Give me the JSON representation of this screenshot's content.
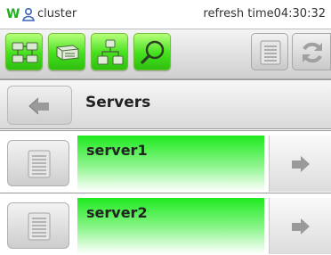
{
  "statusbar": {
    "app_logo": "W",
    "cluster_label": "cluster",
    "refresh_text": "refresh time04:30:32"
  },
  "toolbar": {
    "buttons": [
      {
        "icon": "servers-icon"
      },
      {
        "icon": "server-single-icon"
      },
      {
        "icon": "network-tree-icon"
      },
      {
        "icon": "search-icon"
      }
    ],
    "right_buttons": [
      {
        "icon": "list-icon"
      },
      {
        "icon": "refresh-icon"
      }
    ],
    "colors": {
      "active": "#43e01c",
      "inactive": "#c9c9c9"
    }
  },
  "header": {
    "back_icon": "back-arrow-icon",
    "title": "Servers"
  },
  "servers": [
    {
      "name": "server1",
      "status_color": "#1eea1e"
    },
    {
      "name": "server2",
      "status_color": "#1eea1e"
    }
  ]
}
